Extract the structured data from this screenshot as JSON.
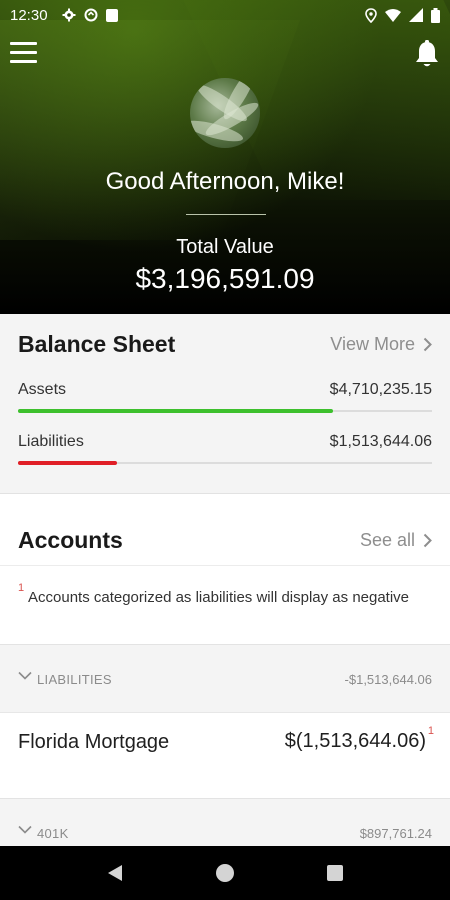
{
  "status_bar": {
    "time": "12:30"
  },
  "header": {
    "greeting": "Good Afternoon, Mike!",
    "total_label": "Total Value",
    "total_value": "$3,196,591.09"
  },
  "balance_sheet": {
    "title": "Balance Sheet",
    "view_more_label": "View More",
    "assets": {
      "label": "Assets",
      "value": "$4,710,235.15",
      "bar_fraction": 0.76,
      "bar_color": "#3dc02d"
    },
    "liabilities": {
      "label": "Liabilities",
      "value": "$1,513,644.06",
      "bar_fraction": 0.24,
      "bar_color": "#e01e26"
    }
  },
  "accounts": {
    "title": "Accounts",
    "see_all_label": "See all",
    "note_marker": "1",
    "note_text": "Accounts categorized as liabilities will display as negative",
    "groups": [
      {
        "name": "LIABILITIES",
        "value": "-$1,513,644.06",
        "items": [
          {
            "name": "Florida Mortgage",
            "value": "$(1,513,644.06)",
            "marker": "1"
          }
        ]
      },
      {
        "name": "401K",
        "value": "$897,761.24"
      }
    ]
  },
  "icons": {
    "status": [
      "gear-icon",
      "sync-icon",
      "sim-card-icon",
      "location-icon",
      "wifi-icon",
      "signal-icon",
      "battery-icon"
    ],
    "header": [
      "menu-icon",
      "bell-icon"
    ],
    "nav": [
      "back-icon",
      "home-icon",
      "recents-icon"
    ]
  },
  "colors": {
    "accent_green": "#3dc02d",
    "accent_red": "#e01e26"
  }
}
